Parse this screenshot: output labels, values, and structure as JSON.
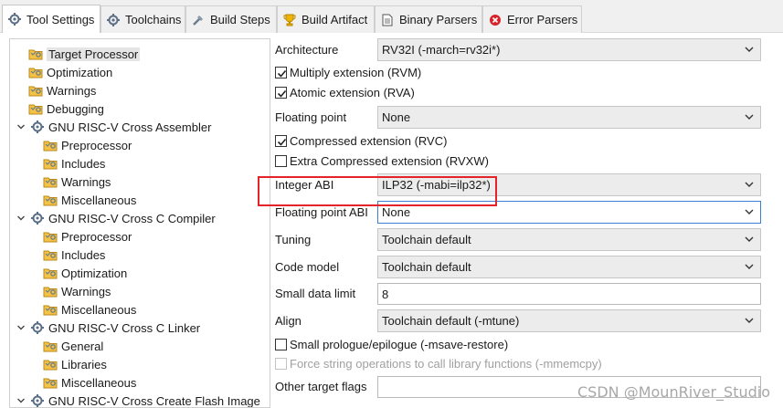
{
  "tabs": [
    {
      "label": "Tool Settings",
      "icon": "tool-settings-icon",
      "active": true
    },
    {
      "label": "Toolchains",
      "icon": "toolchains-icon",
      "active": false
    },
    {
      "label": "Build Steps",
      "icon": "build-steps-icon",
      "active": false
    },
    {
      "label": "Build Artifact",
      "icon": "trophy-icon",
      "active": false
    },
    {
      "label": "Binary Parsers",
      "icon": "binary-parsers-icon",
      "active": false
    },
    {
      "label": "Error Parsers",
      "icon": "error-icon",
      "active": false
    }
  ],
  "tree": [
    {
      "label": "Target Processor",
      "level": 1,
      "selected": true
    },
    {
      "label": "Optimization",
      "level": 1
    },
    {
      "label": "Warnings",
      "level": 1
    },
    {
      "label": "Debugging",
      "level": 1
    },
    {
      "label": "GNU RISC-V Cross Assembler",
      "level": 0
    },
    {
      "label": "Preprocessor",
      "level": 2
    },
    {
      "label": "Includes",
      "level": 2
    },
    {
      "label": "Warnings",
      "level": 2
    },
    {
      "label": "Miscellaneous",
      "level": 2
    },
    {
      "label": "GNU RISC-V Cross C Compiler",
      "level": 0
    },
    {
      "label": "Preprocessor",
      "level": 2
    },
    {
      "label": "Includes",
      "level": 2
    },
    {
      "label": "Optimization",
      "level": 2
    },
    {
      "label": "Warnings",
      "level": 2
    },
    {
      "label": "Miscellaneous",
      "level": 2
    },
    {
      "label": "GNU RISC-V Cross C Linker",
      "level": 0
    },
    {
      "label": "General",
      "level": 2
    },
    {
      "label": "Libraries",
      "level": 2
    },
    {
      "label": "Miscellaneous",
      "level": 2
    },
    {
      "label": "GNU RISC-V Cross Create Flash Image",
      "level": 0
    }
  ],
  "props": {
    "architecture": {
      "label": "Architecture",
      "value": "RV32I (-march=rv32i*)"
    },
    "multiply": {
      "label": "Multiply extension (RVM)",
      "checked": true
    },
    "atomic": {
      "label": "Atomic extension (RVA)",
      "checked": true
    },
    "floating_point": {
      "label": "Floating point",
      "value": "None"
    },
    "compressed": {
      "label": "Compressed extension (RVC)",
      "checked": true
    },
    "extra_compressed": {
      "label": "Extra Compressed extension (RVXW)",
      "checked": false
    },
    "integer_abi": {
      "label": "Integer ABI",
      "value": "ILP32 (-mabi=ilp32*)"
    },
    "fp_abi": {
      "label": "Floating point ABI",
      "value": "None"
    },
    "tuning": {
      "label": "Tuning",
      "value": "Toolchain default"
    },
    "code_model": {
      "label": "Code model",
      "value": "Toolchain default"
    },
    "small_data_limit": {
      "label": "Small data limit",
      "value": "8"
    },
    "align": {
      "label": "Align",
      "value": "Toolchain default (-mtune)"
    },
    "small_prologue": {
      "label": "Small prologue/epilogue (-msave-restore)",
      "checked": false
    },
    "force_string": {
      "label": "Force string operations to call library functions (-mmemcpy)",
      "checked": false,
      "disabled": true
    },
    "other_flags": {
      "label": "Other target flags",
      "value": ""
    }
  },
  "watermark": "CSDN @MounRiver_Studio",
  "colors": {
    "highlight": "#e3242b",
    "focus": "#3b7fd3"
  }
}
